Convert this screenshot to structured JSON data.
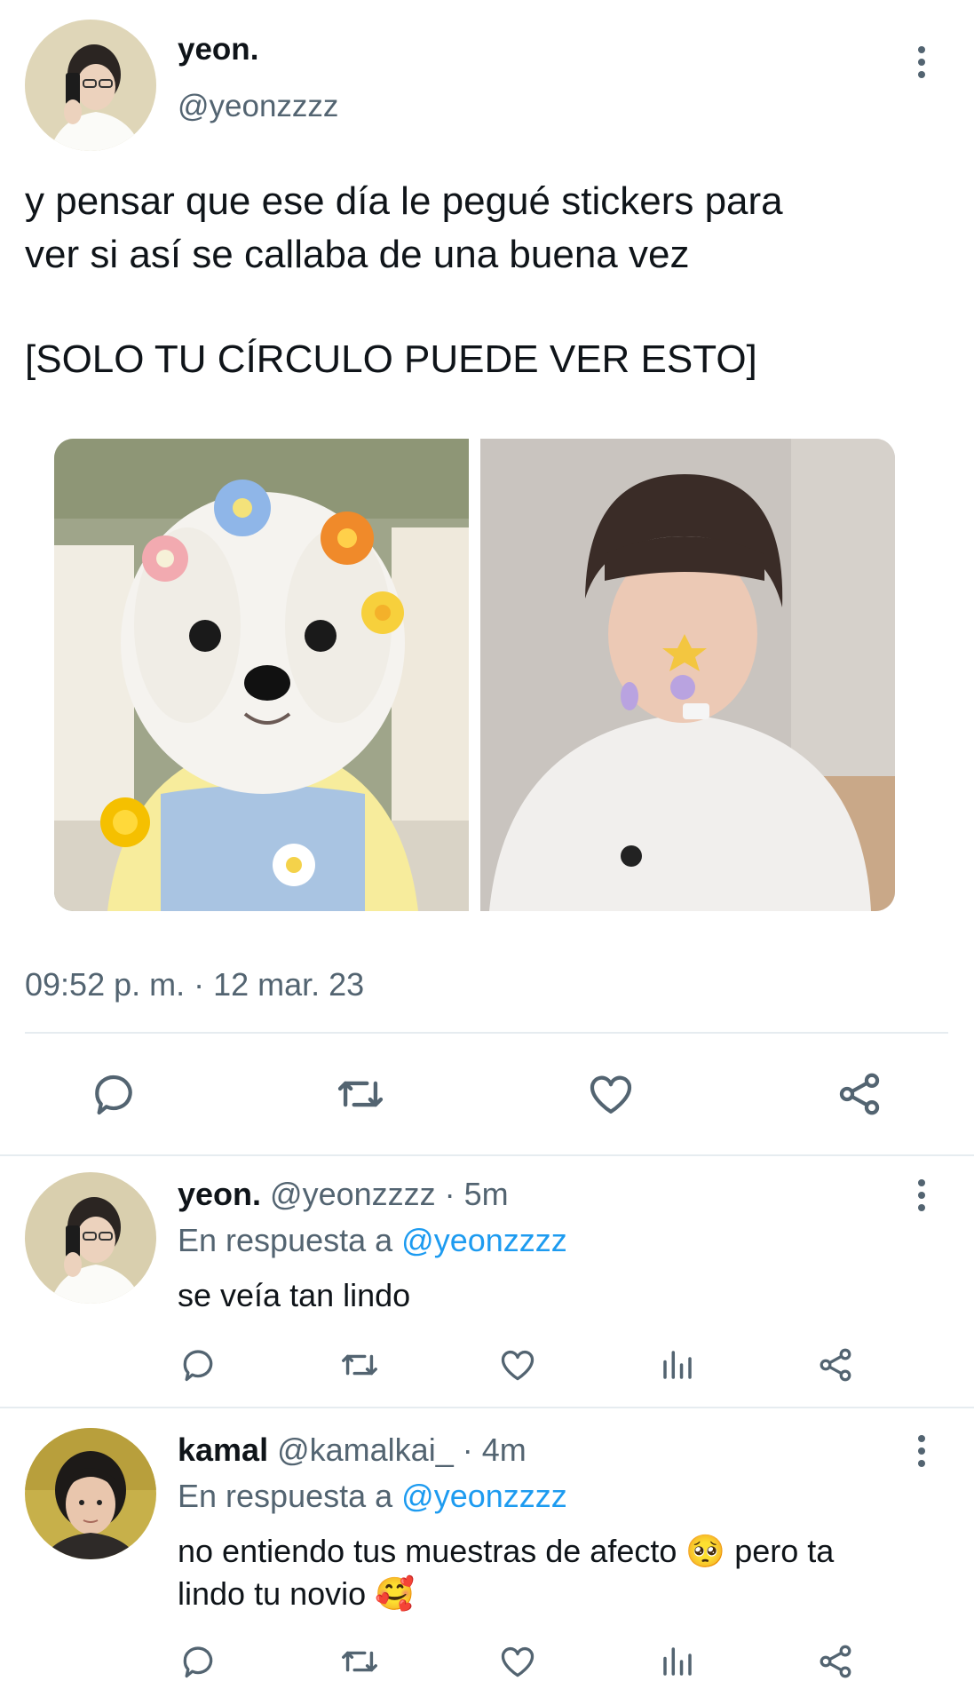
{
  "main_tweet": {
    "display_name": "yeon.",
    "handle": "@yeonzzzz",
    "text_line1": "y pensar que ese día le pegué stickers para",
    "text_line2": "ver si así se callaba de una buena vez",
    "text_notice": "[SOLO TU CÍRCULO PUEDE VER ESTO]",
    "timestamp": "09:52 p. m. · 12 mar. 23",
    "actions": [
      "reply-icon",
      "retweet-icon",
      "like-icon",
      "share-icon"
    ]
  },
  "replies": [
    {
      "display_name": "yeon.",
      "handle": "@yeonzzzz",
      "time": "· 5m",
      "reply_prefix": "En respuesta a",
      "reply_to": "@yeonzzzz",
      "text_line1": "se veía tan lindo",
      "text_line2": ""
    },
    {
      "display_name": "kamal",
      "handle": "@kamalkai_",
      "time": "· 4m",
      "reply_prefix": "En respuesta a",
      "reply_to": "@yeonzzzz",
      "text_line1": "no entiendo tus muestras de afecto 🥺 pero ta",
      "text_line2": "lindo tu novio 🥰"
    }
  ],
  "colors": {
    "muted": "#536471",
    "link": "#1d9bf0",
    "divider": "#e6ecf0"
  }
}
